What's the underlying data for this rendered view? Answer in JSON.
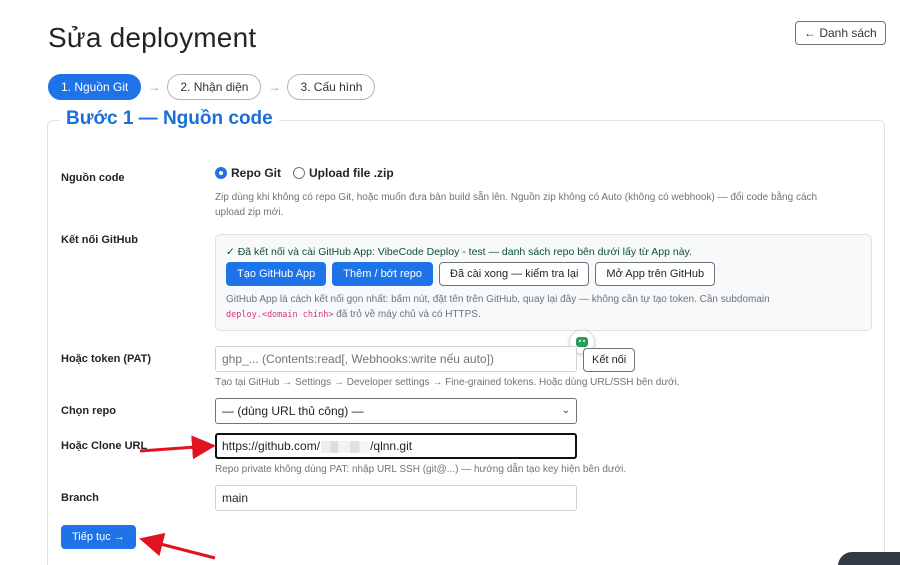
{
  "page": {
    "title": "Sửa deployment",
    "back_label": "← Danh sách"
  },
  "steps": [
    {
      "label": "1. Nguồn Git",
      "active": true
    },
    {
      "label": "2. Nhận diện",
      "active": false
    },
    {
      "label": "3. Cấu hình",
      "active": false
    }
  ],
  "step_separator": "→",
  "section": {
    "legend": "Bước 1 — Nguồn code"
  },
  "source": {
    "label": "Nguồn code",
    "options": [
      {
        "label": "Repo Git",
        "checked": true
      },
      {
        "label": "Upload file .zip",
        "checked": false
      }
    ],
    "help_line1": "Zip dùng khi không có repo Git, hoặc muốn đưa bản build sẵn lên. Nguồn zip không có Auto (không có webhook) — đổi code bằng cách",
    "help_line2": "upload zip mới."
  },
  "github": {
    "label": "Kết nối GitHub",
    "status": "✓ Đã kết nối và cài GitHub App: VibeCode Deploy - test — danh sách repo bên dưới lấy từ App này.",
    "buttons": {
      "create_app": "Tạo GitHub App",
      "add_remove_repo": "Thêm / bớt repo",
      "installed_check": "Đã cài xong — kiểm tra lại",
      "open_app": "Mở App trên GitHub"
    },
    "help_line1": "GitHub App là cách kết nối gọn nhất: bấm nút, đặt tên trên GitHub, quay lại đây — không cần tự tạo token. Cần subdomain",
    "help_code": "deploy.<domain chính>",
    "help_line2_rest": " đã trỏ về máy chủ và có HTTPS."
  },
  "token": {
    "label": "Hoặc token (PAT)",
    "placeholder": "ghp_... (Contents:read[, Webhooks:write nếu auto])",
    "connect_label": "Kết nối",
    "help": "Tạo tại GitHub → Settings → Developer settings → Fine-grained tokens. Hoặc dùng URL/SSH bên dưới."
  },
  "repo": {
    "label": "Chọn repo",
    "selected": "— (dùng URL thủ công) —"
  },
  "clone": {
    "label": "Hoặc Clone URL",
    "value_prefix": "https://github.com/",
    "value_suffix": "/qlnn.git",
    "help": "Repo private không dùng PAT: nhập URL SSH (git@...) — hướng dẫn tạo key hiện bên dưới."
  },
  "branch": {
    "label": "Branch",
    "value": "main"
  },
  "submit_label": "Tiếp tục →",
  "colors": {
    "primary": "#1e73e8",
    "legend": "#1a6fd8",
    "annotation_arrow": "#e0131f"
  },
  "icons": [
    "radio-icon",
    "bot-icon",
    "chevron-down-icon"
  ]
}
